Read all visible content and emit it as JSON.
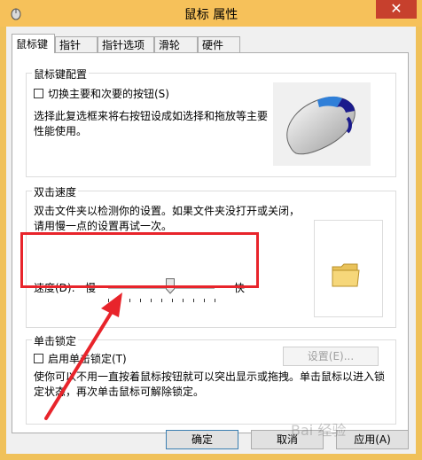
{
  "window": {
    "title": "鼠标 属性",
    "close_label": "✕"
  },
  "tabs": [
    {
      "label": "鼠标键"
    },
    {
      "label": "指针"
    },
    {
      "label": "指针选项"
    },
    {
      "label": "滑轮"
    },
    {
      "label": "硬件"
    }
  ],
  "button_config": {
    "title": "鼠标键配置",
    "checkbox_label": "切换主要和次要的按钮(S)",
    "checked": false,
    "description": "选择此复选框来将右按钮设成如选择和拖放等主要性能使用。"
  },
  "double_click": {
    "title": "双击速度",
    "description": "双击文件夹以检测你的设置。如果文件夹没打开或关闭，请用慢一点的设置再试一次。",
    "speed_label": "速度(D):",
    "slow_label": "慢",
    "fast_label": "快",
    "speed_fraction": 0.6
  },
  "click_lock": {
    "title": "单击锁定",
    "checkbox_label": "启用单击锁定(T)",
    "checked": false,
    "settings_label": "设置(E)...",
    "description": "使你可以不用一直按着鼠标按钮就可以突出显示或拖拽。单击鼠标以进入锁定状态，再次单击鼠标可解除锁定。"
  },
  "footer": {
    "ok_label": "确定",
    "cancel_label": "取消",
    "apply_label": "应用(A)"
  },
  "watermark": {
    "text": "Bai 经验"
  }
}
